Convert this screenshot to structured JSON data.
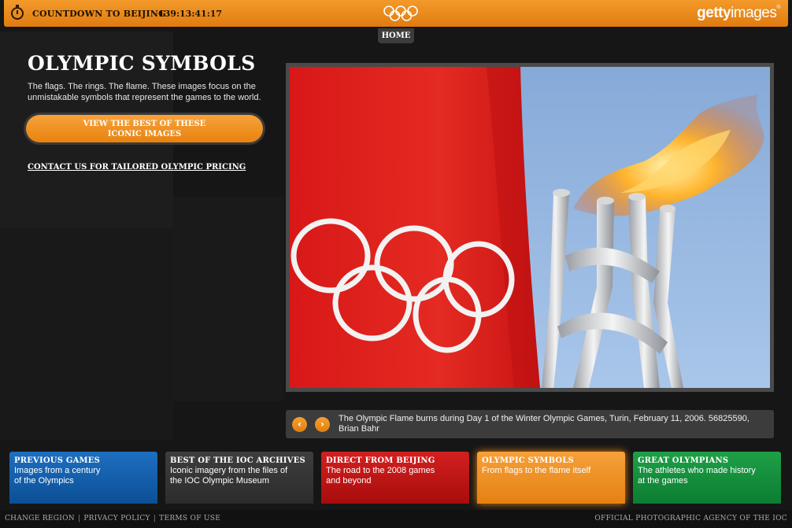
{
  "header": {
    "countdown_label": "COUNTDOWN TO BEIJING",
    "countdown_time": "139:13:41:17",
    "brand_name_a": "getty",
    "brand_name_b": "images",
    "brand_mark": "®",
    "home_label": "HOME",
    "accent_color": "#f08c1e"
  },
  "main": {
    "title": "OLYMPIC SYMBOLS",
    "description": "The flags. The rings. The flame. These images focus on the unmistakable symbols that represent the games to the world.",
    "cta_line1": "VIEW THE BEST OF THESE",
    "cta_line2": "ICONIC IMAGES",
    "contact_link": "CONTACT US FOR TAILORED OLYMPIC PRICING"
  },
  "gallery": {
    "caption": "The Olympic Flame burns during Day 1 of the Winter Olympic Games, Turin, February 11, 2006. 56825590, Brian Bahr",
    "prev_icon": "chevron-left-icon",
    "next_icon": "chevron-right-icon"
  },
  "tiles": [
    {
      "title": "PREVIOUS GAMES",
      "desc_line1": "Images from a century",
      "desc_line2": "of the Olympics"
    },
    {
      "title": "BEST OF THE IOC ARCHIVES",
      "desc_line1": "Iconic imagery from the files of",
      "desc_line2": "the IOC Olympic Museum"
    },
    {
      "title": "DIRECT FROM BEIJING",
      "desc_line1": "The road to the 2008 games",
      "desc_line2": "and beyond"
    },
    {
      "title": "OLYMPIC SYMBOLS",
      "desc_line1": "From flags to the flame itself",
      "desc_line2": ""
    },
    {
      "title": "GREAT OLYMPIANS",
      "desc_line1": "The athletes who made history",
      "desc_line2": "at the games"
    }
  ],
  "footer": {
    "change_region": "CHANGE REGION",
    "privacy": "PRIVACY POLICY",
    "terms": "TERMS OF USE",
    "separator": "|",
    "agency": "OFFICIAL PHOTOGRAPHIC AGENCY OF THE IOC"
  }
}
